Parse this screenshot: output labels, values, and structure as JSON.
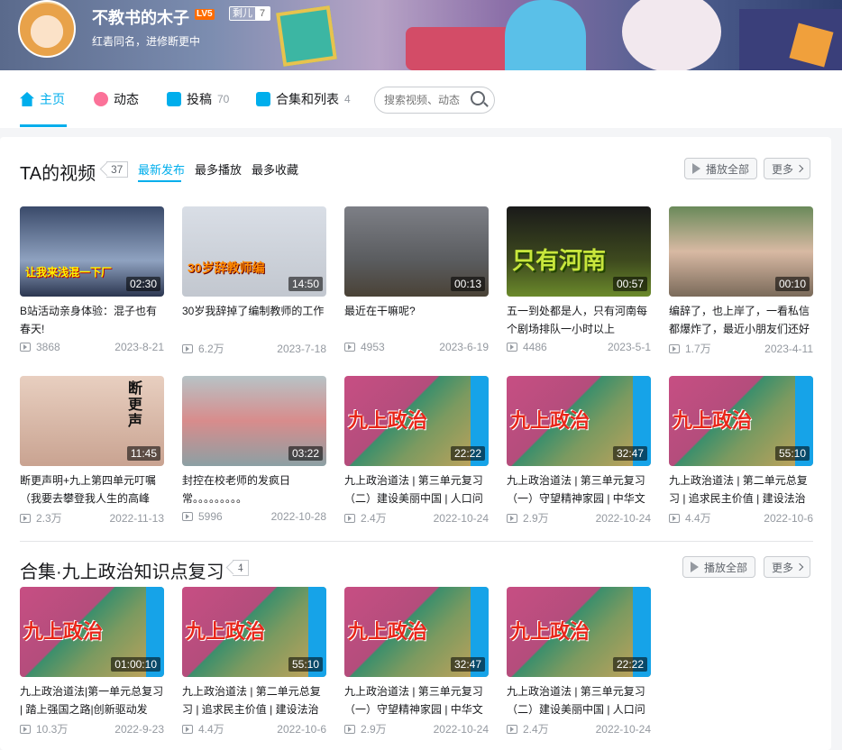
{
  "header": {
    "username": "不教书的木子",
    "level": "LV5",
    "fans_medal": {
      "name": "剩儿",
      "level": "7"
    },
    "signature": "红砉同名，进修断更中"
  },
  "nav": {
    "items": [
      {
        "label": "主页",
        "count": ""
      },
      {
        "label": "动态",
        "count": ""
      },
      {
        "label": "投稿",
        "count": "70"
      },
      {
        "label": "合集和列表",
        "count": "4"
      }
    ],
    "search_placeholder": "搜索视频、动态"
  },
  "videos_section": {
    "title": "TA的视频",
    "count": "37",
    "tabs": [
      "最新发布",
      "最多播放",
      "最多收藏"
    ],
    "play_all": "播放全部",
    "more": "更多",
    "items": [
      {
        "title": "B站活动亲身体验：混子也有春天!",
        "duration": "02:30",
        "plays": "3868",
        "date": "2023-8-21",
        "caption": "让我来浅混一下厂"
      },
      {
        "title": "30岁我辞掉了编制教师的工作",
        "duration": "14:50",
        "plays": "6.2万",
        "date": "2023-7-18",
        "caption": "30岁辞教师编"
      },
      {
        "title": "最近在干嘛呢?",
        "duration": "00:13",
        "plays": "4953",
        "date": "2023-6-19",
        "caption": ""
      },
      {
        "title": "五一到处都是人，只有河南每个剧场排队一小时以上",
        "duration": "00:57",
        "plays": "4486",
        "date": "2023-5-1",
        "caption": "只有河南"
      },
      {
        "title": "编辞了，也上岸了，一看私信都爆炸了，最近小朋友们还好",
        "duration": "00:10",
        "plays": "1.7万",
        "date": "2023-4-11",
        "caption": ""
      },
      {
        "title": "断更声明+九上第四单元叮嘱（我要去攀登我人生的高峰",
        "duration": "11:45",
        "plays": "2.3万",
        "date": "2022-11-13",
        "caption": "断更声"
      },
      {
        "title": "封控在校老师的发疯日常。。。。。。。。。",
        "duration": "03:22",
        "plays": "5996",
        "date": "2022-10-28",
        "caption": ""
      },
      {
        "title": "九上政治道法 | 第三单元复习（二）建设美丽中国 | 人口问",
        "duration": "22:22",
        "plays": "2.4万",
        "date": "2022-10-24",
        "caption": "九上政治"
      },
      {
        "title": "九上政治道法 | 第三单元复习（一）守望精神家园 | 中华文",
        "duration": "32:47",
        "plays": "2.9万",
        "date": "2022-10-24",
        "caption": "九上政治"
      },
      {
        "title": "九上政治道法 | 第二单元总复习 | 追求民主价值 | 建设法治",
        "duration": "55:10",
        "plays": "4.4万",
        "date": "2022-10-6",
        "caption": "九上政治"
      }
    ]
  },
  "collection_section": {
    "title": "合集·九上政治知识点复习",
    "count": "4",
    "play_all": "播放全部",
    "more": "更多",
    "items": [
      {
        "title": "九上政治道法|第一单元总复习 | 踏上强国之路|创新驱动发",
        "duration": "01:00:10",
        "plays": "10.3万",
        "date": "2022-9-23",
        "caption": "九上政治"
      },
      {
        "title": "九上政治道法 | 第二单元总复习 | 追求民主价值 | 建设法治",
        "duration": "55:10",
        "plays": "4.4万",
        "date": "2022-10-6",
        "caption": "九上政治"
      },
      {
        "title": "九上政治道法 | 第三单元复习（一）守望精神家园 | 中华文",
        "duration": "32:47",
        "plays": "2.9万",
        "date": "2022-10-24",
        "caption": "九上政治"
      },
      {
        "title": "九上政治道法 | 第三单元复习（二）建设美丽中国 | 人口问",
        "duration": "22:22",
        "plays": "2.4万",
        "date": "2022-10-24",
        "caption": "九上政治"
      }
    ]
  },
  "colors": {
    "accent": "#00aeec",
    "text": "#18191c",
    "muted": "#9499a0"
  }
}
